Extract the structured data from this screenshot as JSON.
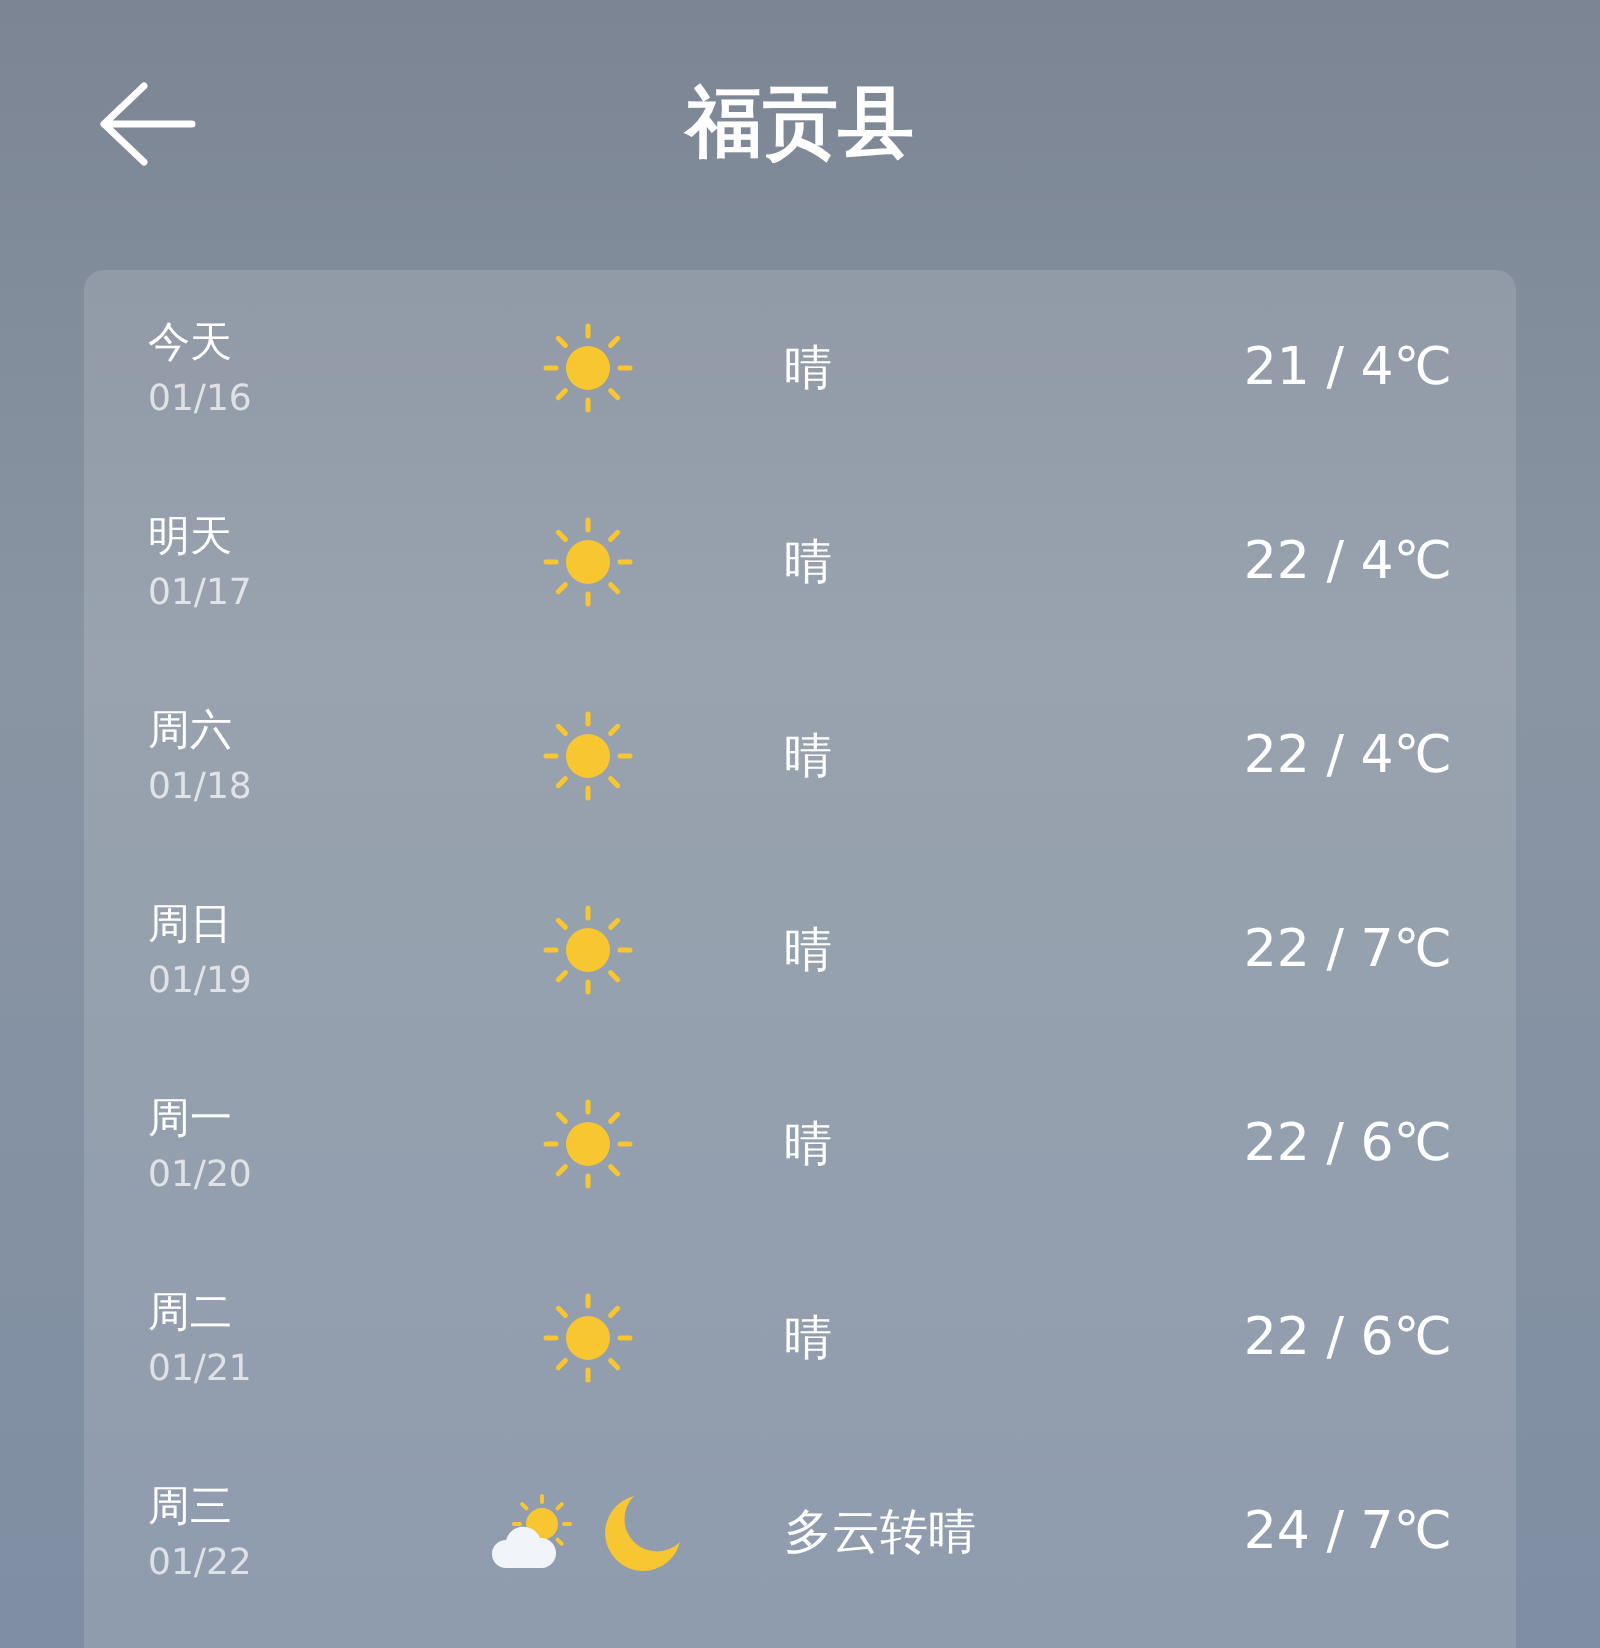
{
  "header": {
    "title": "福贡县"
  },
  "days": [
    {
      "day": "今天",
      "date": "01/16",
      "icons": [
        {
          "kind": "sun"
        }
      ],
      "condition": "晴",
      "temp": "21 / 4℃"
    },
    {
      "day": "明天",
      "date": "01/17",
      "icons": [
        {
          "kind": "sun"
        }
      ],
      "condition": "晴",
      "temp": "22 / 4℃"
    },
    {
      "day": "周六",
      "date": "01/18",
      "icons": [
        {
          "kind": "sun"
        }
      ],
      "condition": "晴",
      "temp": "22 / 4℃"
    },
    {
      "day": "周日",
      "date": "01/19",
      "icons": [
        {
          "kind": "sun"
        }
      ],
      "condition": "晴",
      "temp": "22 / 7℃"
    },
    {
      "day": "周一",
      "date": "01/20",
      "icons": [
        {
          "kind": "sun"
        }
      ],
      "condition": "晴",
      "temp": "22 / 6℃"
    },
    {
      "day": "周二",
      "date": "01/21",
      "icons": [
        {
          "kind": "sun"
        }
      ],
      "condition": "晴",
      "temp": "22 / 6℃"
    },
    {
      "day": "周三",
      "date": "01/22",
      "icons": [
        {
          "kind": "partly-cloudy"
        },
        {
          "kind": "moon"
        }
      ],
      "condition": "多云转晴",
      "temp": "24 / 7℃"
    }
  ]
}
